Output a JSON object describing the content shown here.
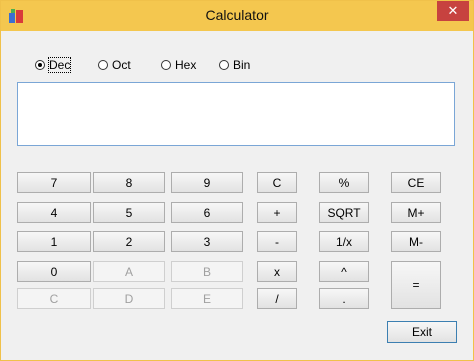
{
  "window": {
    "title": "Calculator",
    "close_label": "✕"
  },
  "radios": [
    {
      "label": "Dec",
      "selected": true
    },
    {
      "label": "Oct",
      "selected": false
    },
    {
      "label": "Hex",
      "selected": false
    },
    {
      "label": "Bin",
      "selected": false
    }
  ],
  "display": {
    "value": ""
  },
  "keys": {
    "k7": "7",
    "k8": "8",
    "k9": "9",
    "k4": "4",
    "k5": "5",
    "k6": "6",
    "k1": "1",
    "k2": "2",
    "k3": "3",
    "k0": "0",
    "kA": "A",
    "kB": "B",
    "kC": "C",
    "kD": "D",
    "kE": "E",
    "clear": "C",
    "plus": "+",
    "minus": "-",
    "times": "x",
    "divide": "/",
    "percent": "%",
    "sqrt": "SQRT",
    "reciprocal": "1/x",
    "power": "^",
    "dot": ".",
    "ce": "CE",
    "mplus": "M+",
    "mminus": "M-",
    "equals": "=",
    "exit": "Exit"
  }
}
